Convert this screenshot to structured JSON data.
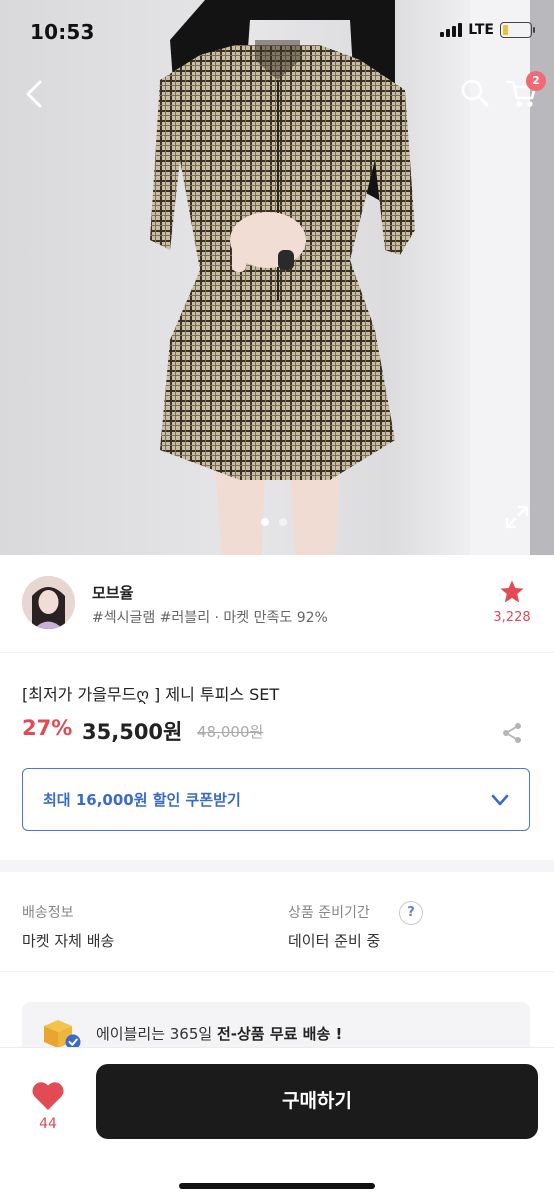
{
  "status_bar": {
    "time": "10:53",
    "network": "LTE"
  },
  "nav": {
    "cart_badge": "2"
  },
  "gallery": {
    "slide_count": 2,
    "active_slide": 1
  },
  "seller": {
    "name": "모브율",
    "subtitle": "#섹시글램 #러블리 · 마켓 만족도 92%",
    "favorite_count": "3,228"
  },
  "product": {
    "title": "[최저가 가을무드ღ ] 제니 투피스 SET",
    "discount": "27%",
    "price": "35,500원",
    "original_price": "48,000원"
  },
  "coupon": {
    "label": "최대 16,000원 할인 쿠폰받기"
  },
  "shipping": {
    "label": "배송정보",
    "value": "마켓 자체 배송",
    "prep_label": "상품 준비기간",
    "prep_value": "데이터 준비 중",
    "help": "?"
  },
  "promo": {
    "prefix": "에이블리는 365일 ",
    "highlight": "전-상품 무료 배송 !"
  },
  "bottom": {
    "like_count": "44",
    "buy_label": "구매하기"
  },
  "colors": {
    "accent_red": "#e24a54",
    "coupon_blue": "#3a6bcc",
    "buy_button": "#1b1b1b",
    "badge": "#f06a76"
  }
}
